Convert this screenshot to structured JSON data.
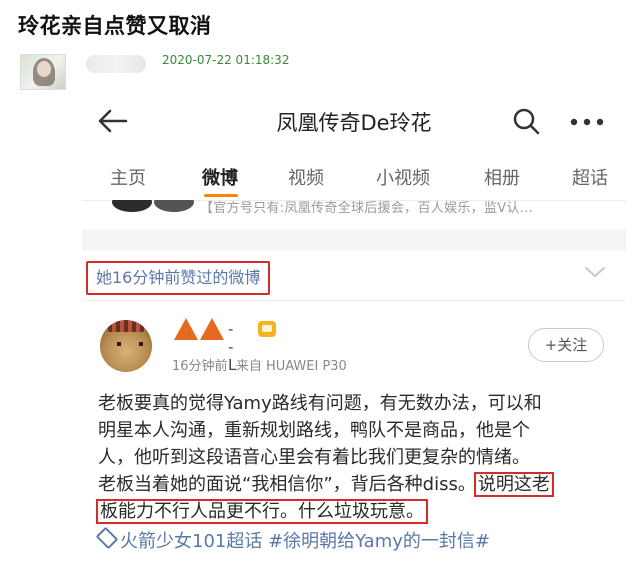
{
  "page": {
    "title": "玲花亲自点赞又取消",
    "timestamp": "2020-07-22 01:18:32"
  },
  "screenshot": {
    "profile_name": "凤凰传奇De玲花",
    "tabs": [
      "主页",
      "微博",
      "视频",
      "小视频",
      "相册",
      "超话"
    ],
    "active_tab": "微博",
    "bio_text": "【官方号只有:凤凰传奇全球后援会，百人娱乐，监V认...",
    "liked_header": "她16分钟前赞过的微博",
    "post": {
      "author_suffix": "--L",
      "time": "16分钟前",
      "source": "来自 HUAWEI P30",
      "follow_label": "+关注",
      "lines": [
        "老板要真的觉得Yamy路线有问题，有无数办法，可以和",
        "明星本人沟通，重新规划路线，鸭队不是商品，他是个",
        "人，他听到这段语音心里会有着比我们更复杂的情绪。",
        "老板当着她的面说“我相信你”，背后各种diss。"
      ],
      "highlight_a": "说明这老",
      "highlight_b": "板能力不行人品更不行。什么垃圾玩意。",
      "hashtags": "火箭少女101超话 #徐明朝给Yamy的一封信#"
    },
    "icons": [
      "back-arrow",
      "search",
      "more",
      "chevron-down",
      "member-crown",
      "topic-diamond"
    ],
    "colors": {
      "accent": "#ff8200",
      "highlight_box": "#d72a2a",
      "link": "#5c78a9",
      "timestamp": "#3a8a3a"
    }
  }
}
